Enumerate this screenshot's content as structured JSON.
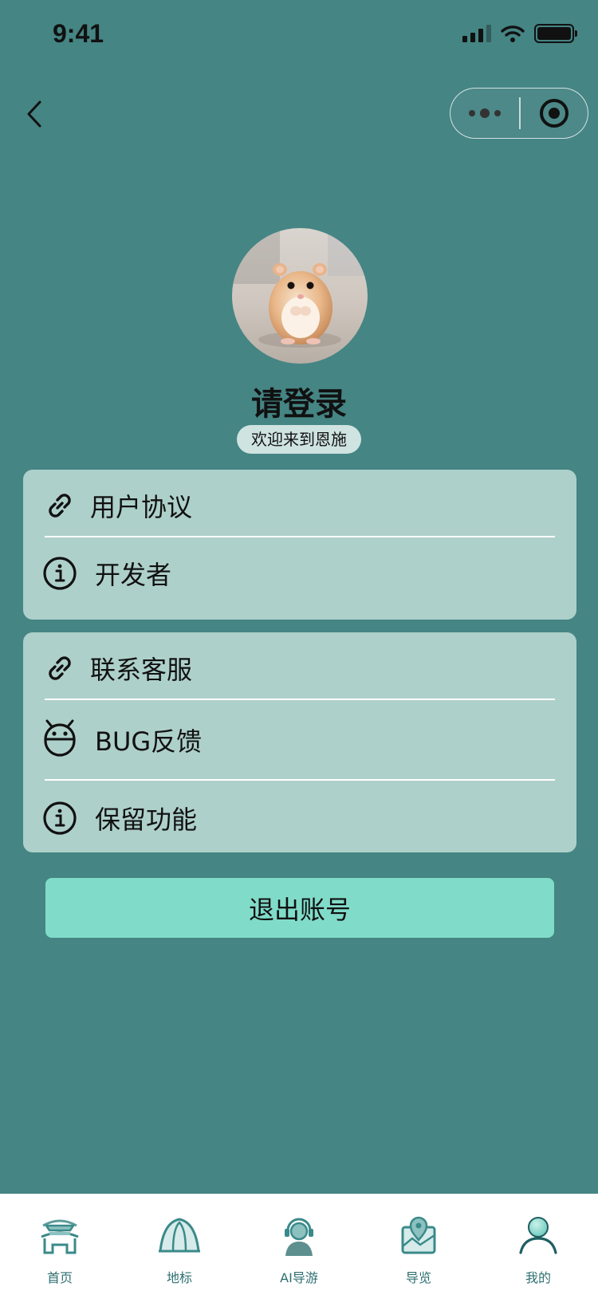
{
  "status_bar": {
    "time": "9:41"
  },
  "profile": {
    "title": "请登录",
    "welcome": "欢迎来到恩施"
  },
  "menu_group_1": [
    {
      "label": "用户协议",
      "icon": "link-icon"
    },
    {
      "label": "开发者",
      "icon": "info-icon"
    }
  ],
  "menu_group_2": [
    {
      "label": "联系客服",
      "icon": "link-icon"
    },
    {
      "label": "BUG反馈",
      "icon": "robot-icon"
    },
    {
      "label": "保留功能",
      "icon": "info-icon"
    }
  ],
  "logout_label": "退出账号",
  "tab_bar": [
    {
      "label": "首页",
      "icon": "gate-icon"
    },
    {
      "label": "地标",
      "icon": "landmark-icon"
    },
    {
      "label": "AI导游",
      "icon": "guide-headset-icon"
    },
    {
      "label": "导览",
      "icon": "map-pin-icon"
    },
    {
      "label": "我的",
      "icon": "user-icon",
      "active": true
    }
  ],
  "colors": {
    "background": "#458584",
    "card": "#aed0ca",
    "logout_button": "#80dcc9",
    "tab_icon": "#3b8a8a"
  }
}
